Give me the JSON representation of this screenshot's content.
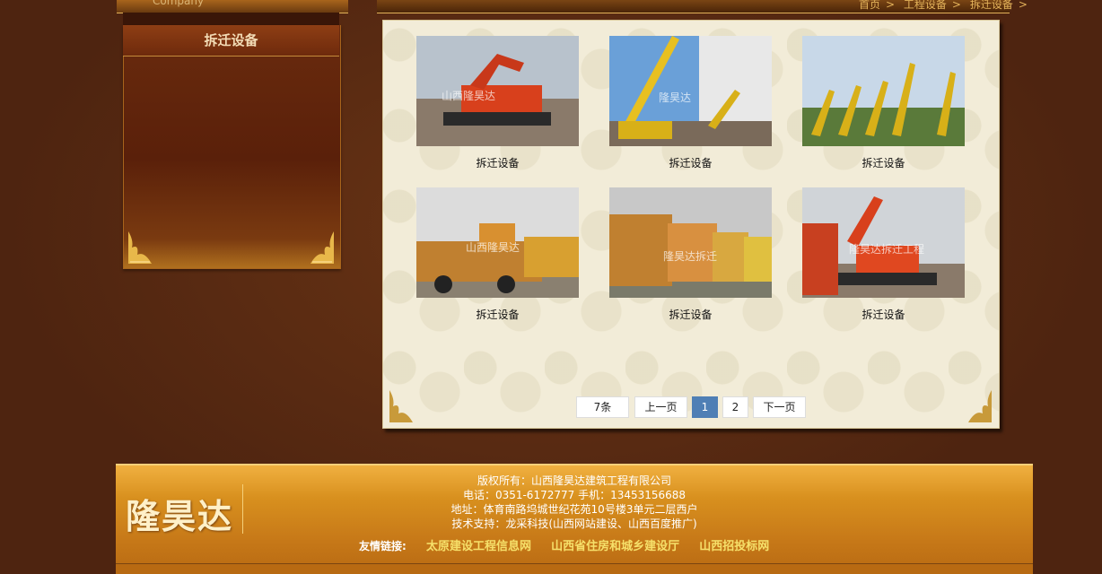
{
  "sidebar": {
    "top_text": "Company",
    "title": "拆迁设备"
  },
  "breadcrumb": {
    "items": [
      "首页",
      "工程设备",
      "拆迁设备"
    ]
  },
  "products": [
    {
      "caption": "拆迁设备",
      "watermark": "山西隆昊达"
    },
    {
      "caption": "拆迁设备",
      "watermark": "隆昊达"
    },
    {
      "caption": "拆迁设备",
      "watermark": ""
    },
    {
      "caption": "拆迁设备",
      "watermark": "山西隆昊达"
    },
    {
      "caption": "拆迁设备",
      "watermark": "隆昊达拆迁"
    },
    {
      "caption": "拆迁设备",
      "watermark": "隆昊达拆迁工程"
    }
  ],
  "pagination": {
    "count": "7条",
    "prev": "上一页",
    "page1": "1",
    "page2": "2",
    "next": "下一页"
  },
  "footer": {
    "logo": "隆昊达",
    "copyright": "版权所有：山西隆昊达建筑工程有限公司",
    "phone": "电话：0351-6172777  手机：13453156688",
    "address": "地址：体育南路坞城世纪花苑10号楼3单元二层西户",
    "support": "技术支持：龙采科技(山西网站建设、山西百度推广)",
    "links_label": "友情链接:",
    "links": [
      "太原建设工程信息网",
      "山西省住房和城乡建设厅",
      "山西招投标网"
    ]
  },
  "colors": {
    "background": "#5a2a10",
    "panel": "#f2ecd8",
    "accent_gold": "#e3b25a",
    "pager_current": "#4f7fb5",
    "footer": "#d8901e",
    "link": "#f6e06a"
  }
}
